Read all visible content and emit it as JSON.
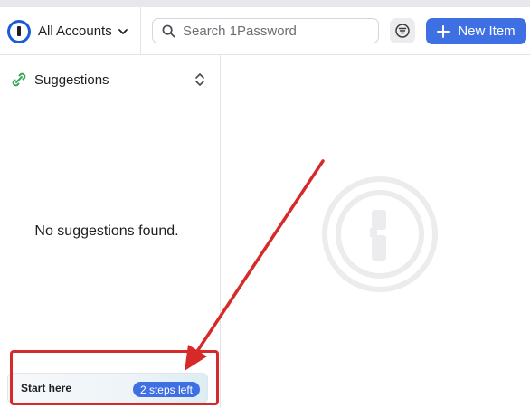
{
  "header": {
    "account_label": "All Accounts",
    "search_placeholder": "Search 1Password",
    "new_item_label": "New Item"
  },
  "sidebar": {
    "section_label": "Suggestions",
    "empty_message": "No suggestions found."
  },
  "start_card": {
    "label": "Start here",
    "badge": "2 steps left"
  },
  "icons": {
    "account": "onepassword-logo-icon",
    "account_chevron": "chevron-down-icon",
    "search": "search-icon",
    "filter": "filter-icon",
    "new": "plus-icon",
    "suggestions": "suggestions-icon",
    "section_toggle": "chevron-updown-icon",
    "watermark": "onepassword-watermark-icon"
  },
  "colors": {
    "accent": "#3e6fe3",
    "logo": "#1a5bd8",
    "annotation": "#d62a2a",
    "suggestions_icon": "#3aa655"
  }
}
